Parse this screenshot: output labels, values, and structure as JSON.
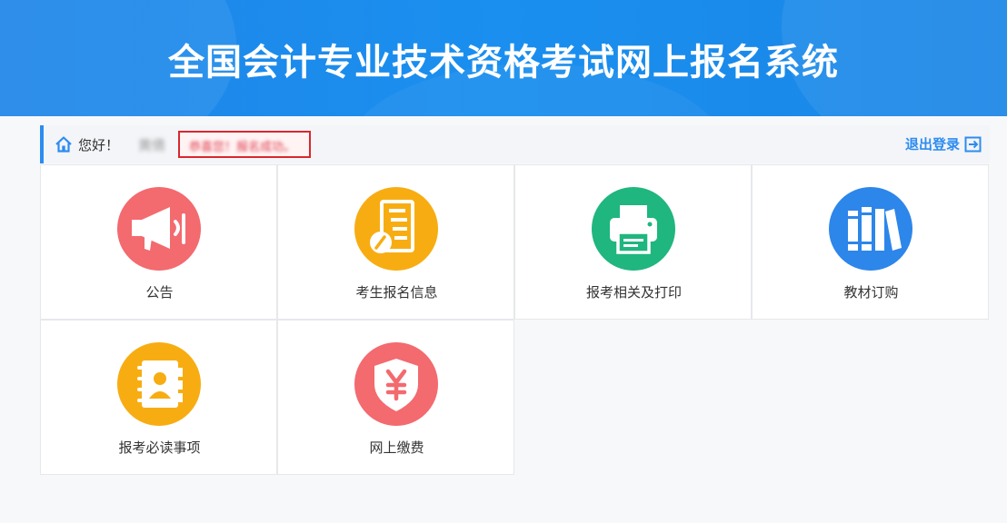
{
  "header": {
    "title": "全国会计专业技术资格考试网上报名系统"
  },
  "welcome": {
    "greeting": "您好！",
    "username": "黄倩",
    "success_message": "恭喜您！报名成功。",
    "logout_label": "退出登录"
  },
  "tiles": [
    {
      "label": "公告",
      "icon": "megaphone-icon",
      "color": "#f36a6f"
    },
    {
      "label": "考生报名信息",
      "icon": "form-icon",
      "color": "#f7ad12"
    },
    {
      "label": "报考相关及打印",
      "icon": "printer-icon",
      "color": "#1fb67f"
    },
    {
      "label": "教材订购",
      "icon": "books-icon",
      "color": "#2d86ea"
    },
    {
      "label": "报考必读事项",
      "icon": "contact-book-icon",
      "color": "#f7ad12"
    },
    {
      "label": "网上缴费",
      "icon": "yuan-shield-icon",
      "color": "#f36a6f"
    }
  ],
  "colors": {
    "header": "#1f86e8",
    "accent": "#2d8cf0",
    "highlight": "#d9272e"
  }
}
